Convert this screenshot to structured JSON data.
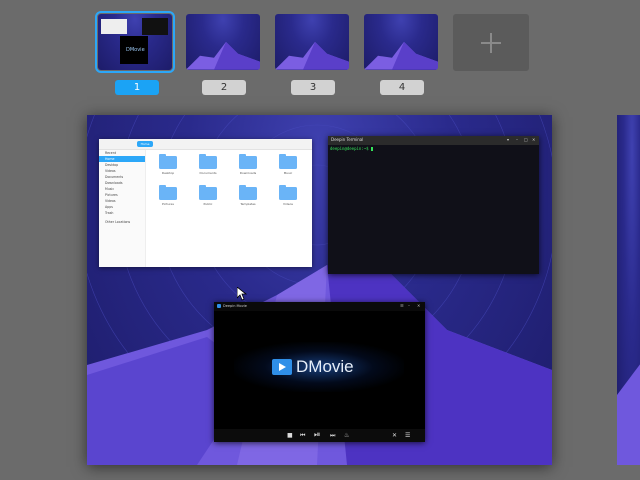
{
  "workspaces": [
    {
      "label": "1",
      "active": true
    },
    {
      "label": "2",
      "active": false
    },
    {
      "label": "3",
      "active": false
    },
    {
      "label": "4",
      "active": false
    }
  ],
  "add_workspace_label": "+",
  "file_manager": {
    "breadcrumb": "Home",
    "sidebar": [
      "Recent",
      "Home",
      "Desktop",
      "Videos",
      "Documents",
      "Downloads",
      "Music",
      "Pictures",
      "Videos",
      "Apps",
      "Trash",
      "Other Locations"
    ],
    "selected_sidebar_index": 1,
    "folders": [
      "Desktop",
      "Documents",
      "Downloads",
      "Music",
      "Pictures",
      "Public",
      "Templates",
      "Videos"
    ]
  },
  "terminal": {
    "title": "Deepin Terminal",
    "prompt": "deepin@deepin:~$"
  },
  "player": {
    "title": "Deepin Movie",
    "brand": "DMovie"
  },
  "colors": {
    "accent": "#1ba3f5",
    "background": "#6b6b6b",
    "wallpaper": "#2a2a8c",
    "prompt": "#35e45a"
  }
}
